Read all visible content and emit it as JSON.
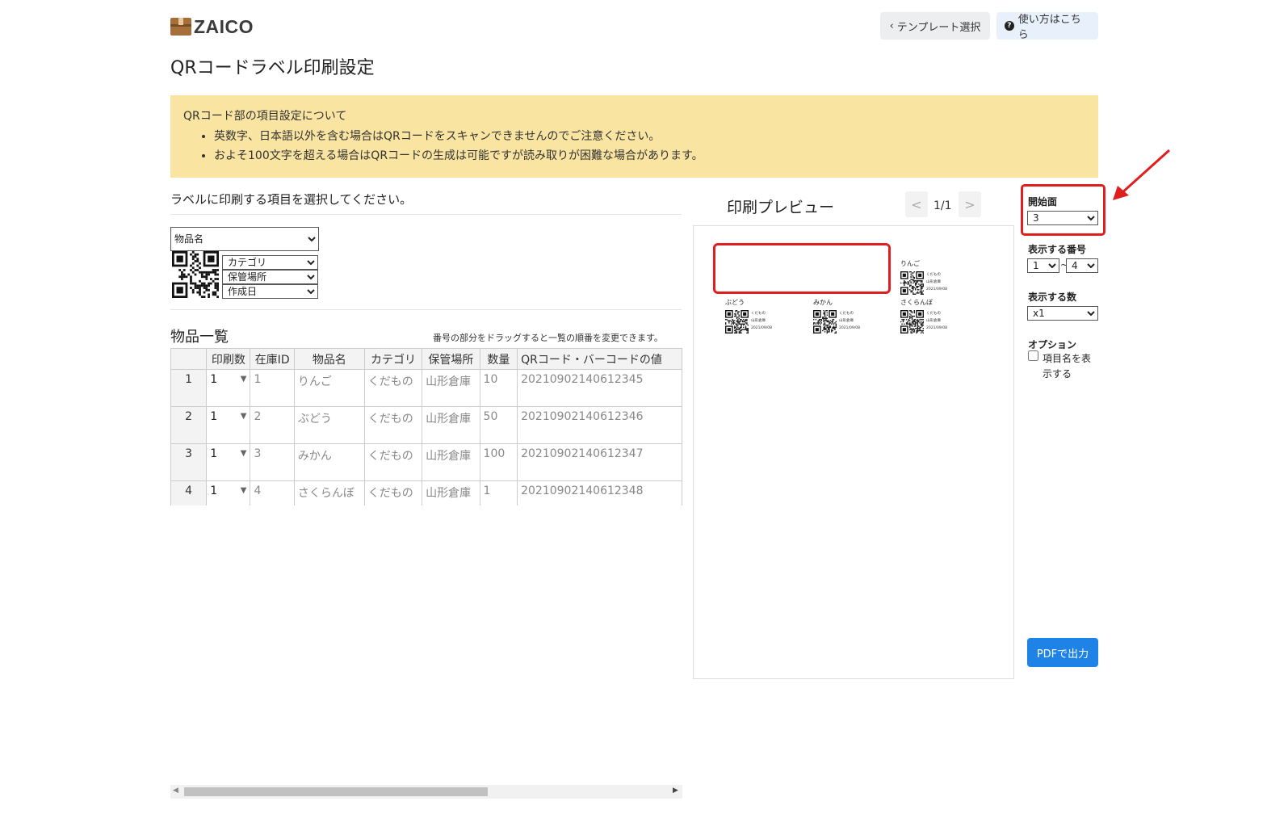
{
  "header": {
    "logo_text": "ZAICO",
    "template_button": "テンプレート選択",
    "help_button": "使い方はこちら",
    "page_title": "QRコードラベル印刷設定"
  },
  "notice": {
    "title": "QRコード部の項目設定について",
    "items": [
      "英数字、日本語以外を含む場合はQRコードをスキャンできませんのでご注意ください。",
      "およそ100文字を超える場合はQRコードの生成は可能ですが読み取りが困難な場合があります。"
    ]
  },
  "field_select": {
    "title": "ラベルに印刷する項目を選択してください。",
    "main_field": "物品名",
    "sub_fields": [
      "カテゴリ",
      "保管場所",
      "作成日"
    ]
  },
  "item_list": {
    "title": "物品一覧",
    "hint": "番号の部分をドラッグすると一覧の順番を変更できます。",
    "columns": [
      "印刷数",
      "在庫ID",
      "物品名",
      "カテゴリ",
      "保管場所",
      "数量",
      "QRコード・バーコードの値"
    ],
    "rows": [
      {
        "no": "1",
        "print": "1",
        "id": "1",
        "name": "りんご",
        "category": "くだもの",
        "place": "山形倉庫",
        "qty": "10",
        "code": "20210902140612345"
      },
      {
        "no": "2",
        "print": "1",
        "id": "2",
        "name": "ぶどう",
        "category": "くだもの",
        "place": "山形倉庫",
        "qty": "50",
        "code": "20210902140612346"
      },
      {
        "no": "3",
        "print": "1",
        "id": "3",
        "name": "みかん",
        "category": "くだもの",
        "place": "山形倉庫",
        "qty": "100",
        "code": "20210902140612347"
      },
      {
        "no": "4",
        "print": "1",
        "id": "4",
        "name": "さくらんぼ",
        "category": "くだもの",
        "place": "山形倉庫",
        "qty": "1",
        "code": "20210902140612348"
      }
    ]
  },
  "preview": {
    "title": "印刷プレビュー",
    "page_count": "1/1",
    "prev_icon": "<",
    "next_icon": ">",
    "labels": [
      {
        "name": "りんご",
        "category": "くだもの",
        "place": "山形倉庫",
        "date": "2021/09/08"
      },
      {
        "name": "ぶどう",
        "category": "くだもの",
        "place": "山形倉庫",
        "date": "2021/09/08"
      },
      {
        "name": "みかん",
        "category": "くだもの",
        "place": "山形倉庫",
        "date": "2021/09/08"
      },
      {
        "name": "さくらんぼ",
        "category": "くだもの",
        "place": "山形倉庫",
        "date": "2021/09/08"
      }
    ]
  },
  "settings": {
    "start_label": "開始面",
    "start_value": "3",
    "number_label": "表示する番号",
    "number_from": "1",
    "number_sep": "~",
    "number_to": "4",
    "count_label": "表示する数",
    "count_value": "x1",
    "option_label": "オプション",
    "option_show_name": "項目名を表示する",
    "option_checked": false,
    "pdf_button": "PDFで出力"
  },
  "colors": {
    "highlight": "#e01e1e",
    "notice_bg": "#f9e4a1",
    "primary": "#1e82e6"
  }
}
